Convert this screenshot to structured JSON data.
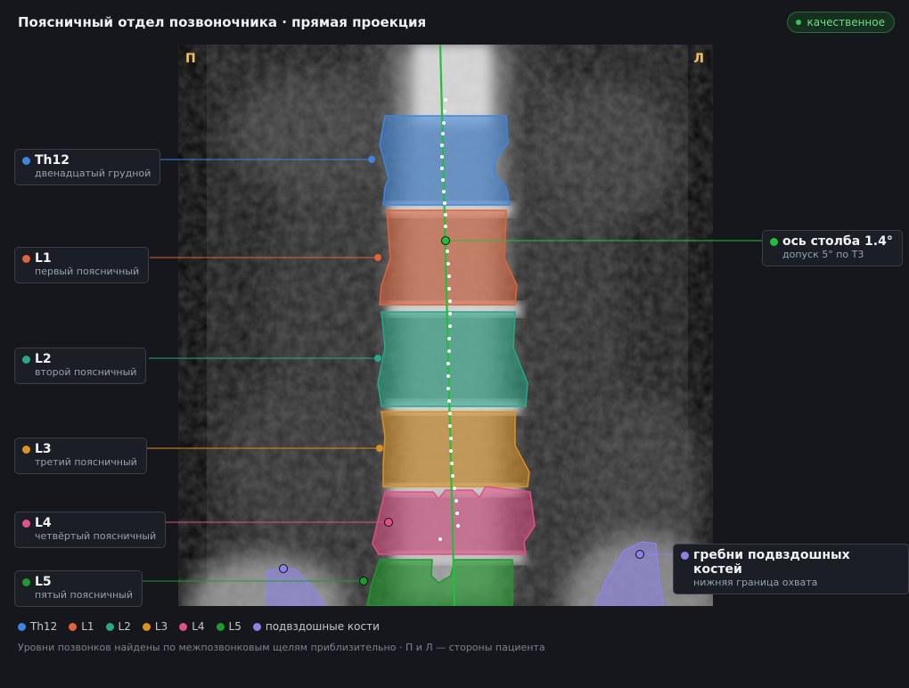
{
  "header": {
    "title": "Поясничный отдел позвоночника · прямая проекция",
    "quality_badge": "качественное",
    "quality_color": "#36c455"
  },
  "image": {
    "side_left": "П",
    "side_right": "Л",
    "side_color": "#f0c060"
  },
  "vertebrae": [
    {
      "id": "th12",
      "name": "Th12",
      "desc": "двенадцатый грудной",
      "color": "#3d86e0"
    },
    {
      "id": "l1",
      "name": "L1",
      "desc": "первый поясничный",
      "color": "#e0633a"
    },
    {
      "id": "l2",
      "name": "L2",
      "desc": "второй поясничный",
      "color": "#27a887"
    },
    {
      "id": "l3",
      "name": "L3",
      "desc": "третий поясничный",
      "color": "#dc9220"
    },
    {
      "id": "l4",
      "name": "L4",
      "desc": "четвёртый поясничный",
      "color": "#e34f86"
    },
    {
      "id": "l5",
      "name": "L5",
      "desc": "пятый поясничный",
      "color": "#1f9a2c"
    }
  ],
  "axis": {
    "name": "ось столба 1.4°",
    "desc": "допуск 5° по Т3",
    "angle_deg": 1.4,
    "color": "#22c038"
  },
  "iliac": {
    "name": "гребни подвздошных костей",
    "desc": "нижняя граница охвата",
    "color": "#8b84e8"
  },
  "legend": [
    {
      "label": "Th12",
      "color": "#3d86e0"
    },
    {
      "label": "L1",
      "color": "#e0633a"
    },
    {
      "label": "L2",
      "color": "#27a887"
    },
    {
      "label": "L3",
      "color": "#dc9220"
    },
    {
      "label": "L4",
      "color": "#e34f86"
    },
    {
      "label": "L5",
      "color": "#1f9a2c"
    },
    {
      "label": "подвздошные кости",
      "color": "#8b84e8"
    }
  ],
  "footnote": "Уровни позвонков найдены по межпозвонковым щелям приблизительно · П и Л — стороны пациента"
}
